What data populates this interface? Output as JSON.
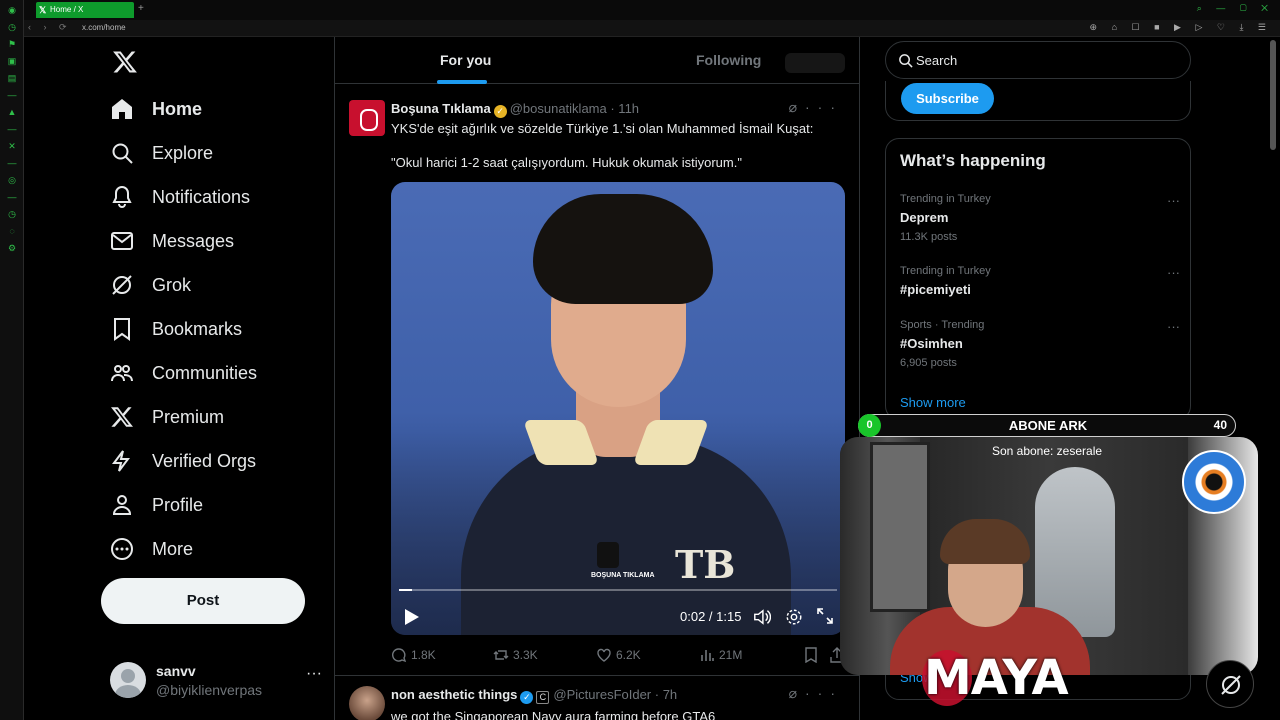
{
  "browser": {
    "tab_title": "Home / X",
    "url": "x.com/home",
    "new_tab": "+",
    "nav": "‹ › ⟳",
    "ext_icons": "⊕ ⌂ ☐ ■ ▶ ▷ ♡ ⤓ ☰",
    "window_controls": "⌕ — ▢ ✕"
  },
  "sidebar": {
    "items": [
      {
        "label": "Home",
        "icon": "home-icon"
      },
      {
        "label": "Explore",
        "icon": "search-icon"
      },
      {
        "label": "Notifications",
        "icon": "bell-icon"
      },
      {
        "label": "Messages",
        "icon": "envelope-icon"
      },
      {
        "label": "Grok",
        "icon": "grok-icon"
      },
      {
        "label": "Bookmarks",
        "icon": "bookmark-icon"
      },
      {
        "label": "Communities",
        "icon": "people-icon"
      },
      {
        "label": "Premium",
        "icon": "x-icon"
      },
      {
        "label": "Verified Orgs",
        "icon": "lightning-icon"
      },
      {
        "label": "Profile",
        "icon": "person-icon"
      },
      {
        "label": "More",
        "icon": "more-circle-icon"
      }
    ],
    "post_label": "Post",
    "account": {
      "name": "sanvv",
      "handle": "@biyiklienverpas",
      "more": "···"
    }
  },
  "timeline": {
    "tabs": [
      "For you",
      "Following"
    ],
    "tweet1": {
      "name": "Boşuna Tıklama",
      "handle": "@bosunatiklama",
      "time": "· 11h",
      "line1": "YKS'de eşit ağırlık ve sözelde Türkiye 1.'si olan Muhammed İsmail Kuşat:",
      "line2": "\"Okul harici 1-2 saat çalışıyordum. Hukuk okumak istiyorum.\"",
      "video_time": "0:02 / 1:15",
      "video_progress": 0.03,
      "video_logo": "BOŞUNA TIKLAMA",
      "chest_logo": "TB",
      "stats": {
        "replies": "1.8K",
        "reposts": "3.3K",
        "likes": "6.2K",
        "views": "21M"
      }
    },
    "tweet2": {
      "name": "non aesthetic things",
      "badge": "C",
      "handle": "@PicturesFoIder",
      "time": "· 7h",
      "text": "we got the Singaporean Navy aura farming before GTA6"
    }
  },
  "right": {
    "search_placeholder": "Search",
    "subscribe_label": "Subscribe",
    "happening_title": "What’s happening",
    "trends": [
      {
        "meta": "Trending in Turkey",
        "name": "Deprem",
        "count": "11.3K posts"
      },
      {
        "meta": "Trending in Turkey",
        "name": "#picemiyeti",
        "count": ""
      },
      {
        "meta": "Sports · Trending",
        "name": "#Osimhen",
        "count": "6,905 posts"
      }
    ],
    "show_more": "Show more",
    "show_more_partial": "Show"
  },
  "overlay": {
    "sub_goal_current": "0",
    "sub_goal_label": "ABONE ARK",
    "sub_goal_target": "40",
    "last_sub": "Son abone: zeserale",
    "brand": "MAYA"
  },
  "colors": {
    "accent": "#1d9bf0",
    "verified_gold": "#e6b325",
    "sub_green": "#19c52a",
    "browser_green": "#0e9b2c"
  }
}
